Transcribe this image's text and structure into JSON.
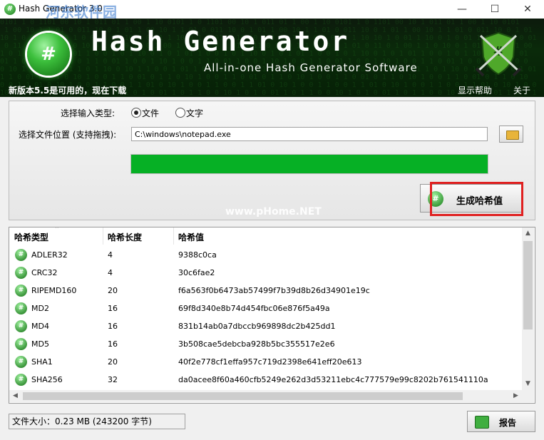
{
  "window": {
    "title": "Hash Generator 3.0",
    "minimize": "—",
    "maximize": "☐",
    "close": "✕",
    "watermark": "河东软件园"
  },
  "banner": {
    "app_name": "Hash Generator",
    "tagline": "All-in-one Hash Generator Software",
    "update_notice": "新版本5.5是可用的，现在下载",
    "help_link": "显示帮助",
    "about_link": "关于",
    "logo_glyph": "#"
  },
  "input": {
    "type_label": "选择输入类型:",
    "option_file": "文件",
    "option_text": "文字",
    "selected": "文件",
    "path_label": "选择文件位置 (支持拖拽):",
    "path_value": "C:\\windows\\notepad.exe",
    "progress": 1.0
  },
  "generate_button": {
    "label": "生成哈希值",
    "icon": "hash-icon"
  },
  "site_watermark": "www.pHome.NET",
  "table": {
    "columns": [
      "哈希类型",
      "哈希长度",
      "哈希值"
    ],
    "rows": [
      {
        "type": "ADLER32",
        "length": "4",
        "value": "9388c0ca"
      },
      {
        "type": "CRC32",
        "length": "4",
        "value": "30c6fae2"
      },
      {
        "type": "RIPEMD160",
        "length": "20",
        "value": "f6a563f0b6473ab57499f7b39d8b26d34901e19c"
      },
      {
        "type": "MD2",
        "length": "16",
        "value": "69f8d340e8b74d454fbc06e876f5a49a"
      },
      {
        "type": "MD4",
        "length": "16",
        "value": "831b14ab0a7dbccb969898dc2b425dd1"
      },
      {
        "type": "MD5",
        "length": "16",
        "value": "3b508cae5debcba928b5bc355517e2e6"
      },
      {
        "type": "SHA1",
        "length": "20",
        "value": "40f2e778cf1effa957c719d2398e641eff20e613"
      },
      {
        "type": "SHA256",
        "length": "32",
        "value": "da0acee8f60a460cfb5249e262d3d53211ebc4c777579e99c8202b761541110a"
      }
    ]
  },
  "status": {
    "file_size": "文件大小：0.23 MB (243200 字节)"
  },
  "report_button": {
    "label": "报告"
  }
}
